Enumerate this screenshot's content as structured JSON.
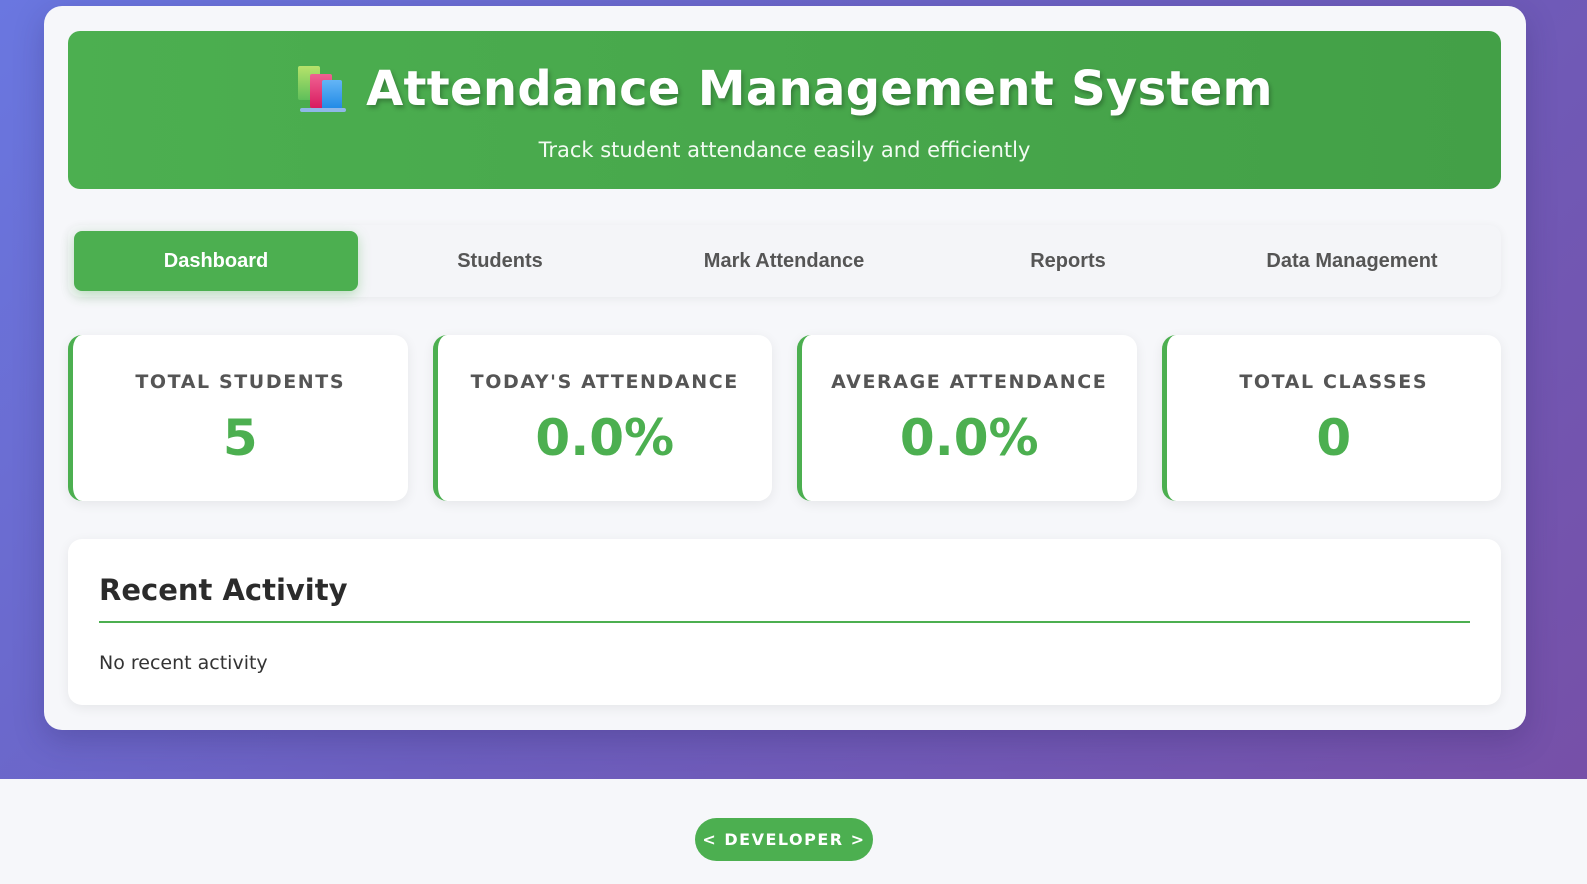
{
  "header": {
    "title": "Attendance Management System",
    "subtitle": "Track student attendance easily and efficiently",
    "icon": "books-icon"
  },
  "nav": {
    "tabs": [
      {
        "label": "Dashboard",
        "active": true
      },
      {
        "label": "Students",
        "active": false
      },
      {
        "label": "Mark Attendance",
        "active": false
      },
      {
        "label": "Reports",
        "active": false
      },
      {
        "label": "Data Management",
        "active": false
      }
    ]
  },
  "stats": [
    {
      "label": "TOTAL STUDENTS",
      "value": "5"
    },
    {
      "label": "TODAY'S ATTENDANCE",
      "value": "0.0%"
    },
    {
      "label": "AVERAGE ATTENDANCE",
      "value": "0.0%"
    },
    {
      "label": "TOTAL CLASSES",
      "value": "0"
    }
  ],
  "recent_activity": {
    "title": "Recent Activity",
    "empty_text": "No recent activity"
  },
  "footer": {
    "developer_button": "< DEVELOPER >"
  },
  "colors": {
    "accent": "#4caf50",
    "background_gradient_start": "#6a77e0",
    "background_gradient_end": "#7650a8"
  }
}
